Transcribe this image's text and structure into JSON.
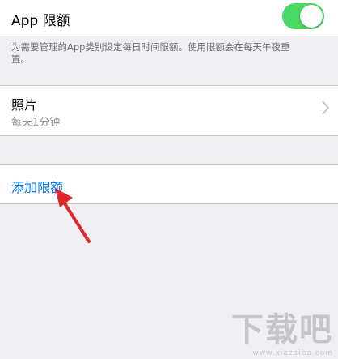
{
  "app_limits": {
    "title": "App 限额",
    "toggle_on": true,
    "accent_color": "#4cd964",
    "footnote": "为需要管理的App类别设定每日时间限额。使用限额会在每天午夜重置。"
  },
  "limit_row": {
    "app_name": "照片",
    "limit_text": "每天1分钟",
    "chevron_icon": "chevron-right-icon"
  },
  "add_limit": {
    "label": "添加限额",
    "link_color": "#007aff"
  },
  "annotation": {
    "arrow_color": "#e0272b",
    "arrow_icon": "red-pointer-arrow"
  },
  "watermark": {
    "text": "下载吧",
    "sub": "www.xiazaiba.com"
  }
}
